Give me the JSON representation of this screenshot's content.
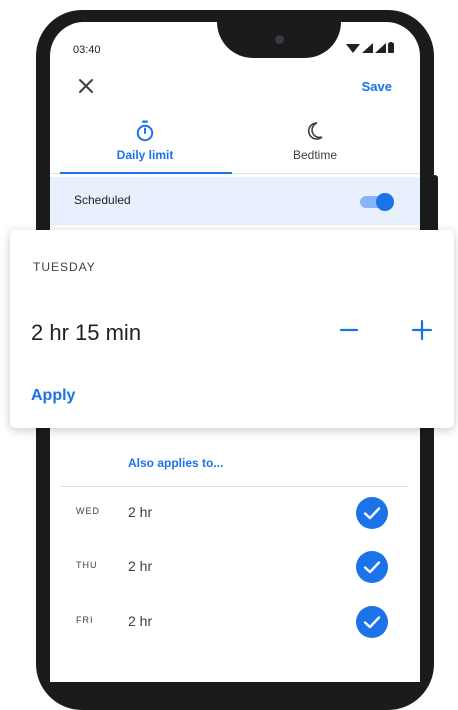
{
  "status_bar": {
    "time": "03:40"
  },
  "header": {
    "save_label": "Save"
  },
  "tabs": [
    {
      "label": "Daily limit",
      "icon": "timer-icon",
      "selected": true
    },
    {
      "label": "Bedtime",
      "icon": "moon-icon",
      "selected": false
    }
  ],
  "scheduled": {
    "label": "Scheduled",
    "enabled": true
  },
  "card": {
    "day": "TUESDAY",
    "duration": "2 hr 15 min",
    "apply_label": "Apply"
  },
  "also_applies": "Also applies to...",
  "days": [
    {
      "abbr": "WED",
      "value": "2 hr",
      "checked": true
    },
    {
      "abbr": "THU",
      "value": "2 hr",
      "checked": true
    },
    {
      "abbr": "FRI",
      "value": "2 hr",
      "checked": true
    }
  ],
  "colors": {
    "accent": "#1a73e8",
    "scheduled_bg": "#e8f0fe",
    "toggle_track": "#8ab4f8",
    "frame": "#1b1b1b"
  }
}
